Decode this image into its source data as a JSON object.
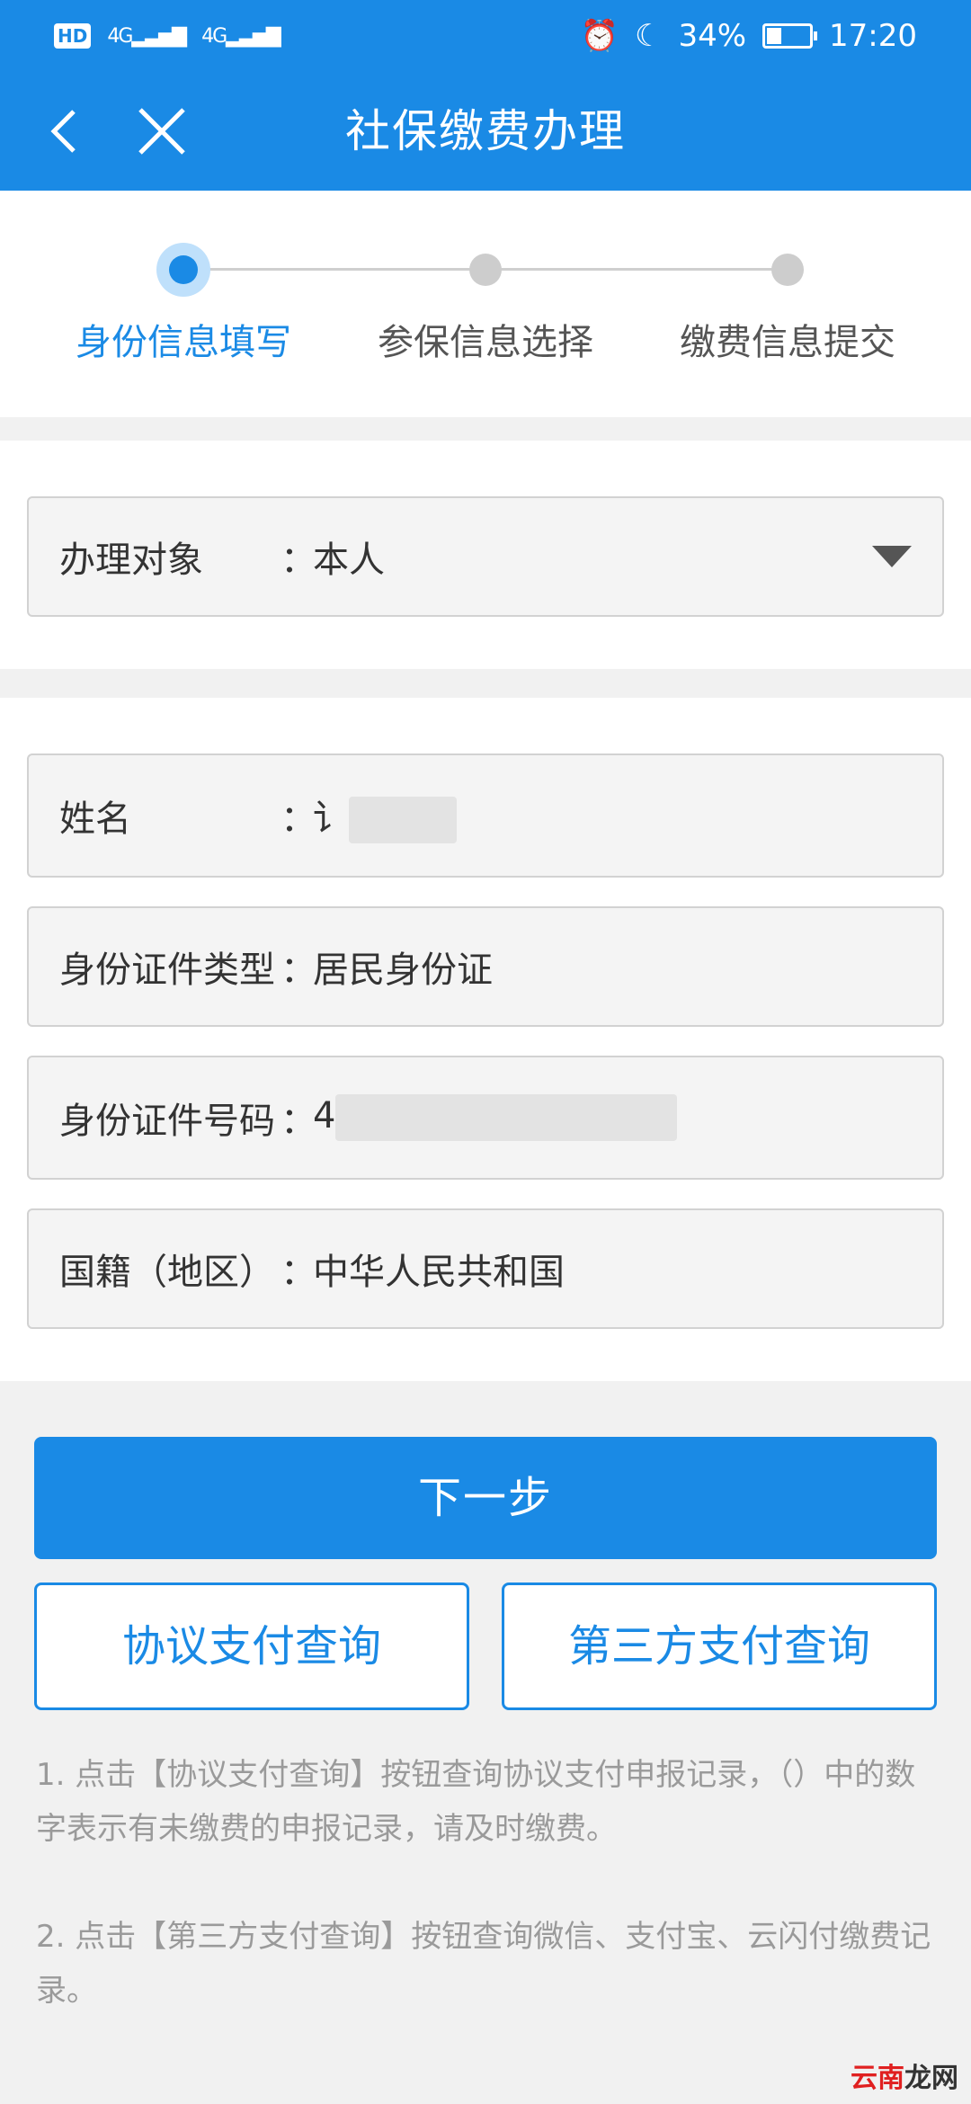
{
  "status_bar": {
    "left_badge": "HD",
    "network_1": "4G",
    "network_2": "4G",
    "battery_percent": "34%",
    "time": "17:20"
  },
  "header": {
    "title": "社保缴费办理"
  },
  "steps": [
    {
      "label": "身份信息填写",
      "active": true
    },
    {
      "label": "参保信息选择",
      "active": false
    },
    {
      "label": "缴费信息提交",
      "active": false
    }
  ],
  "form": {
    "target": {
      "label": "办理对象",
      "value": "本人"
    },
    "name": {
      "label": "姓名",
      "value": "讠"
    },
    "id_type": {
      "label": "身份证件类型",
      "value": "居民身份证"
    },
    "id_number": {
      "label": "身份证件号码",
      "value": "4"
    },
    "nationality": {
      "label": "国籍（地区）",
      "value": "中华人民共和国"
    },
    "colon": "："
  },
  "buttons": {
    "next": "下一步",
    "agreement_query": "协议支付查询",
    "third_party_query": "第三方支付查询"
  },
  "notes": {
    "note1": "1. 点击【协议支付查询】按钮查询协议支付申报记录，（）中的数字表示有未缴费的申报记录，请及时缴费。",
    "note2": "2. 点击【第三方支付查询】按钮查询微信、支付宝、云闪付缴费记录。"
  },
  "watermark": {
    "part1": "云南",
    "part2": "龙网"
  },
  "colors": {
    "primary": "#1a8ae5",
    "background": "#f1f1f1"
  }
}
